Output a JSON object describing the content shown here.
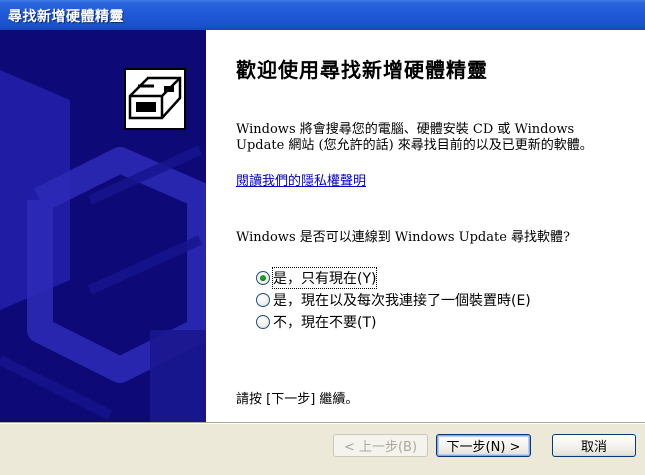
{
  "window": {
    "title": "尋找新增硬體精靈"
  },
  "main": {
    "heading": "歡迎使用尋找新增硬體精靈",
    "intro": "Windows 將會搜尋您的電腦、硬體安裝 CD 或 Windows Update 網站 (您允許的話) 來尋找目前的以及已更新的軟體。",
    "privacy_link": "閱讀我們的隱私權聲明",
    "question": "Windows 是否可以連線到 Windows Update 尋找軟體?",
    "options": [
      {
        "label": "是，只有現在(Y)",
        "checked": true
      },
      {
        "label": "是，現在以及每次我連接了一個裝置時(E)",
        "checked": false
      },
      {
        "label": "不，現在不要(T)",
        "checked": false
      }
    ],
    "continue_text": "請按 [下一步] 繼續。"
  },
  "buttons": {
    "back": "< 上一步(B)",
    "next": "下一步(N) >",
    "cancel": "取消"
  },
  "colors": {
    "titlebar": "#1f58d6",
    "sidepanel": "#0d0a78",
    "dialog_bg": "#ece9d8"
  }
}
